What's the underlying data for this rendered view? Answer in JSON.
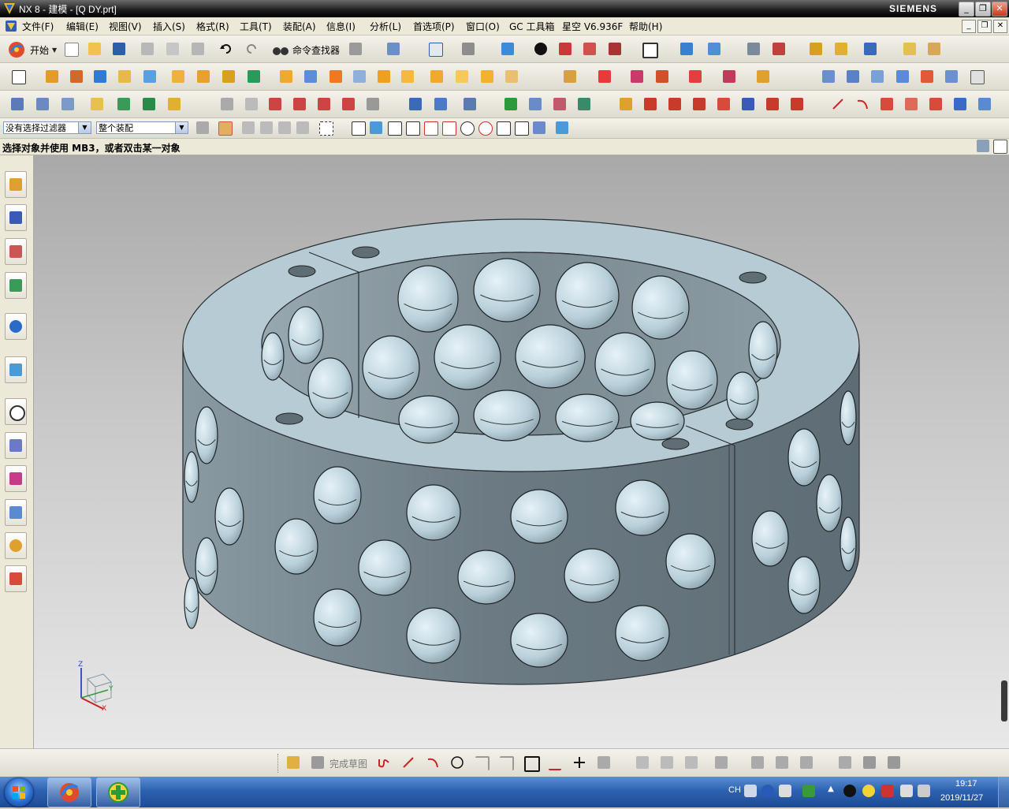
{
  "window": {
    "title": "NX 8 - 建模 - [Q DY.prt]",
    "brand": "SIEMENS",
    "controls": {
      "minimize": "_",
      "restore": "❐",
      "close": "✕"
    }
  },
  "menubar": {
    "items": [
      "文件(F)",
      "编辑(E)",
      "视图(V)",
      "插入(S)",
      "格式(R)",
      "工具(T)",
      "装配(A)",
      "信息(I)",
      "分析(L)",
      "首选项(P)",
      "窗口(O)",
      "GC 工具箱",
      "星空 V6.936F",
      "帮助(H)"
    ]
  },
  "toolbar": {
    "start_label": "开始",
    "command_finder_label": "命令查找器"
  },
  "selection_bar": {
    "filter_value": "没有选择过滤器",
    "scope_value": "整个装配"
  },
  "status": {
    "prompt": "选择对象并使用 MB3，或者双击某一对象"
  },
  "triad": {
    "z": "Z",
    "y": "Y",
    "x": "X"
  },
  "sketch_toolbar": {
    "finish_sketch_label": "完成草图"
  },
  "taskbar": {
    "lang": "CH",
    "time": "19:17",
    "date": "2019/11/27"
  },
  "colors": {
    "part_top": "#b9cdd6",
    "part_side": "#6f7e86",
    "viewport_top": "#a9a9a9",
    "viewport_bottom": "#e8e8e8",
    "taskbar": "#2d62b2"
  }
}
